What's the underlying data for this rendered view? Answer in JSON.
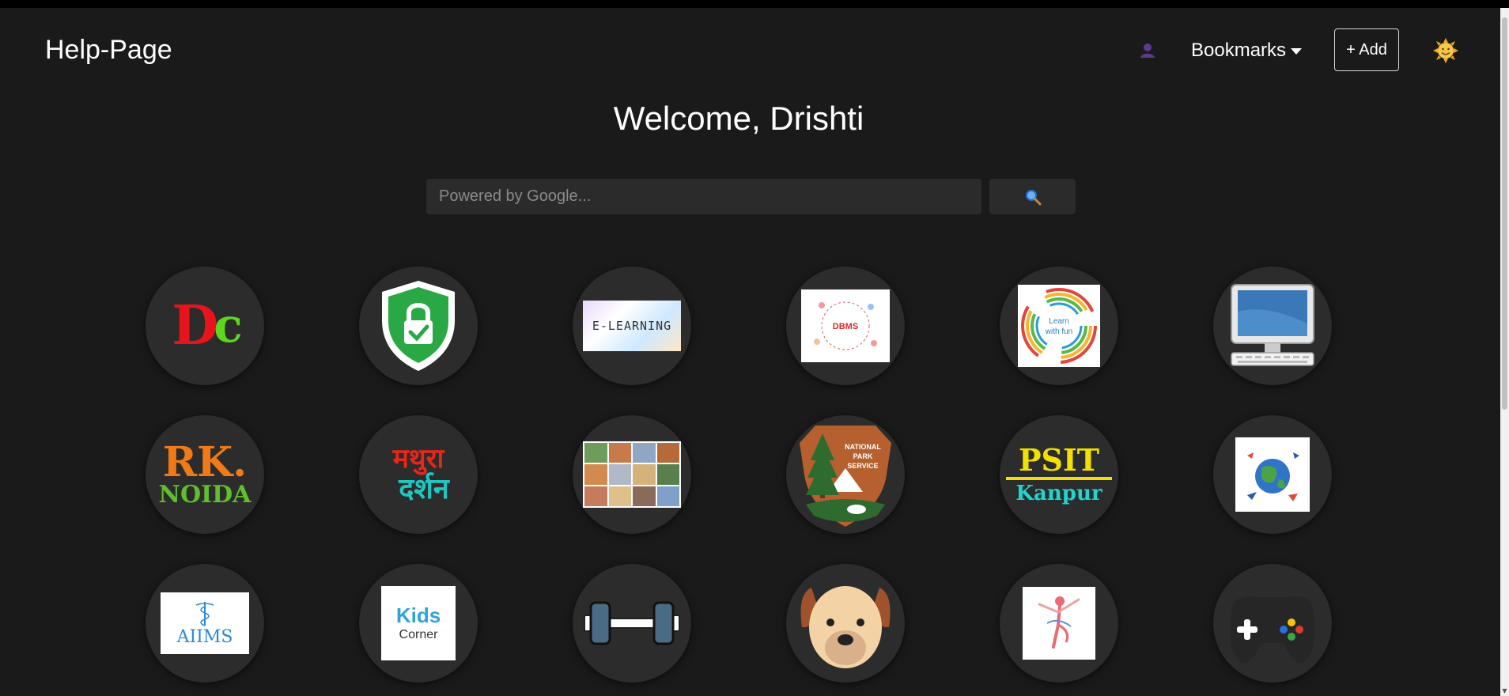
{
  "brand": {
    "title": "Help-Page"
  },
  "nav": {
    "bookmarks_label": "Bookmarks",
    "add_label": "+ Add"
  },
  "welcome": {
    "text": "Welcome, Drishti"
  },
  "search": {
    "placeholder": "Powered by Google..."
  },
  "tiles": [
    {
      "icon": "dc-logo-icon",
      "text": "Dc"
    },
    {
      "icon": "security-shield-icon"
    },
    {
      "icon": "e-learning-icon",
      "text": "E-LEARNING"
    },
    {
      "icon": "dbms-icon",
      "text": "DBMS"
    },
    {
      "icon": "learn-with-fun-icon",
      "text": "Learn with fun"
    },
    {
      "icon": "computer-icon"
    },
    {
      "icon": "rk-noida-logo-icon",
      "text": "RK.",
      "text2": "NOIDA"
    },
    {
      "icon": "mathura-darshan-icon",
      "text": "मथुरा",
      "text2": "दर्शन"
    },
    {
      "icon": "monuments-collage-icon"
    },
    {
      "icon": "national-park-service-icon",
      "text": "NATIONAL PARK SERVICE"
    },
    {
      "icon": "psit-kanpur-logo-icon",
      "text": "PSIT",
      "text2": "Kanpur"
    },
    {
      "icon": "travel-globe-icon"
    },
    {
      "icon": "aiims-logo-icon",
      "text": "AIIMS"
    },
    {
      "icon": "kids-corner-icon",
      "text": "Kids",
      "text2": "Corner"
    },
    {
      "icon": "dumbbell-icon"
    },
    {
      "icon": "dog-icon"
    },
    {
      "icon": "dancer-icon"
    },
    {
      "icon": "gamepad-icon"
    }
  ],
  "colors": {
    "background": "#1a1a1a",
    "tile": "#2c2c2c",
    "input": "#2b2b2b"
  }
}
